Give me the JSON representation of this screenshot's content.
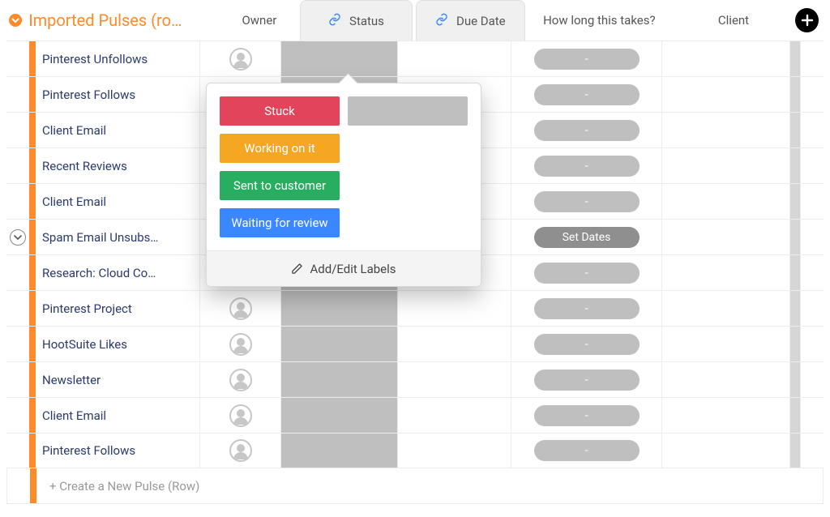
{
  "group": {
    "title": "Imported Pulses (ro…",
    "accent_color": "#ff8a2a"
  },
  "columns": {
    "owner": {
      "label": "Owner"
    },
    "status": {
      "label": "Status",
      "linked": true
    },
    "due": {
      "label": "Due Date",
      "linked": true
    },
    "duration": {
      "label": "How long this takes?"
    },
    "client": {
      "label": "Client"
    }
  },
  "rows": [
    {
      "name": "Pinterest Unfollows",
      "has_avatar": true,
      "expandable": false,
      "duration_label": "-"
    },
    {
      "name": "Pinterest Follows",
      "has_avatar": false,
      "expandable": false,
      "duration_label": "-"
    },
    {
      "name": "Client Email",
      "has_avatar": false,
      "expandable": false,
      "duration_label": "-"
    },
    {
      "name": "Recent Reviews",
      "has_avatar": false,
      "expandable": false,
      "duration_label": "-"
    },
    {
      "name": "Client Email",
      "has_avatar": false,
      "expandable": false,
      "duration_label": "-"
    },
    {
      "name": "Spam Email Unsubs…",
      "has_avatar": false,
      "expandable": true,
      "duration_label": "Set Dates",
      "duration_dark": true
    },
    {
      "name": "Research: Cloud Co…",
      "has_avatar": false,
      "expandable": false,
      "duration_label": "-"
    },
    {
      "name": "Pinterest Project",
      "has_avatar": true,
      "expandable": false,
      "duration_label": "-"
    },
    {
      "name": "HootSuite Likes",
      "has_avatar": true,
      "expandable": false,
      "duration_label": "-"
    },
    {
      "name": "Newsletter",
      "has_avatar": true,
      "expandable": false,
      "duration_label": "-"
    },
    {
      "name": "Client Email",
      "has_avatar": true,
      "expandable": false,
      "duration_label": "-"
    },
    {
      "name": "Pinterest Follows",
      "has_avatar": true,
      "expandable": false,
      "duration_label": "-"
    }
  ],
  "new_row_placeholder": "+ Create a New Pulse (Row)",
  "status_popover": {
    "options": {
      "stuck": "Stuck",
      "working": "Working on it",
      "sent": "Sent to customer",
      "waiting": "Waiting for review"
    },
    "footer": "Add/Edit Labels"
  }
}
